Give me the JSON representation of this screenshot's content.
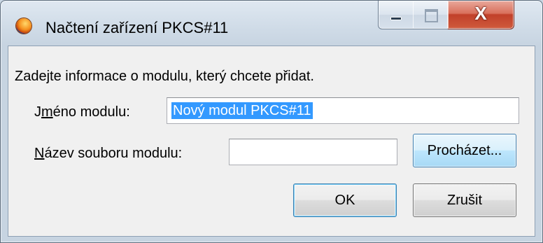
{
  "window": {
    "title": "Načtení zařízení PKCS#11",
    "controls": {
      "minimize": "minimize",
      "maximize": "maximize",
      "close": "X"
    }
  },
  "dialog": {
    "instruction": "Zadejte informace o modulu, který chcete přidat.",
    "module_name": {
      "label_pre": "J",
      "label_accel": "m",
      "label_post": "éno modulu:",
      "value": "Nový modul PKCS#11"
    },
    "module_file": {
      "label_accel": "N",
      "label_post": "ázev souboru modulu:",
      "value": "",
      "browse_label": "Procházet..."
    },
    "ok_label": "OK",
    "cancel_label": "Zrušit"
  }
}
